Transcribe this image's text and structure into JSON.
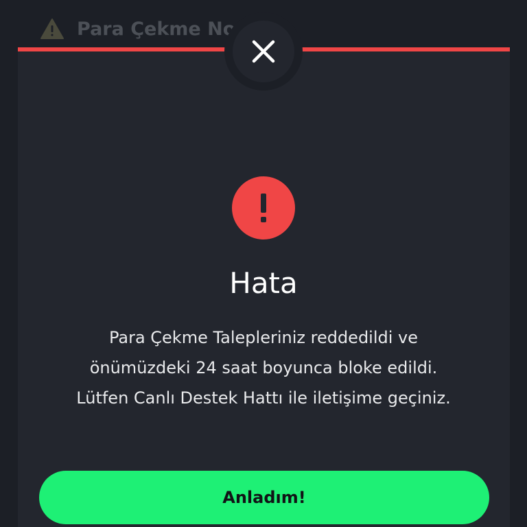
{
  "background": {
    "title": "Para Çekme No",
    "icon": "warning-triangle-icon"
  },
  "modal": {
    "close_icon": "close-icon",
    "status_icon": "exclamation-icon",
    "title": "Hata",
    "message": "Para Çekme Talepleriniz reddedildi ve önümüzdeki 24 saat boyunca bloke edildi. Lütfen Canlı Destek Hattı ile iletişime geçiniz.",
    "confirm_label": "Anladım!"
  },
  "colors": {
    "accent_red": "#f04646",
    "button_green": "#1ef075",
    "modal_bg": "#23262e",
    "page_bg": "#1c1f26"
  }
}
